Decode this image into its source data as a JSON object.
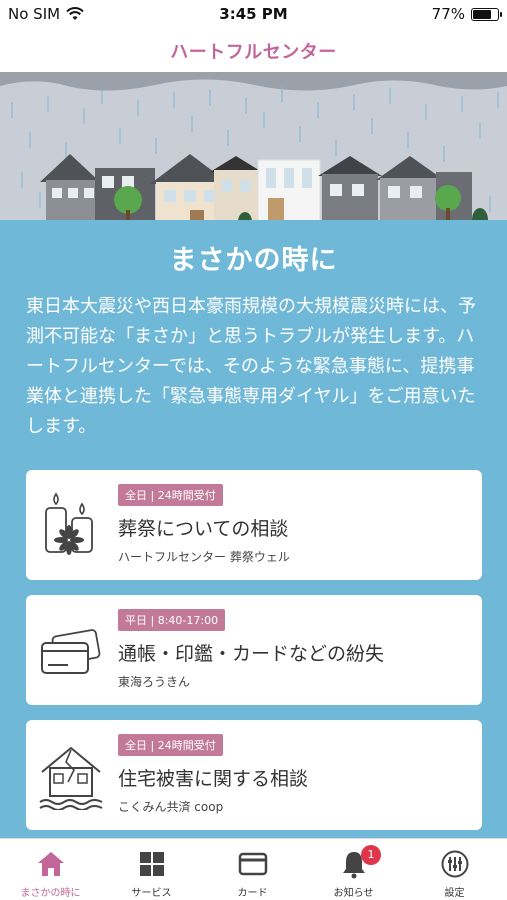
{
  "status_bar": {
    "carrier": "No SIM",
    "time": "3:45 PM",
    "battery_percent": "77%",
    "battery_level": 0.77
  },
  "nav": {
    "title": "ハートフルセンター"
  },
  "main": {
    "section_title": "まさかの時に",
    "description": "東日本大震災や西日本豪雨規模の大規模震災時には、予測不可能な「まさか」と思うトラブルが発生します。ハートフルセンターでは、そのような緊急事態に、提携事業体と連携した「緊急事態専用ダイヤル」をご用意いたします。",
    "cards": [
      {
        "badge": "全日 | 24時間受付",
        "title": "葬祭についての相談",
        "subtitle": "ハートフルセンター 葬祭ウェル",
        "icon": "candles-icon"
      },
      {
        "badge": "平日 | 8:40-17:00",
        "title": "通帳・印鑑・カードなどの紛失",
        "subtitle": "東海ろうきん",
        "icon": "cards-icon"
      },
      {
        "badge": "全日 | 24時間受付",
        "title": "住宅被害に関する相談",
        "subtitle": "こくみん共済 coop",
        "icon": "damaged-house-icon"
      }
    ]
  },
  "tabs": [
    {
      "label": "まさかの時に",
      "icon": "home-icon",
      "active": true
    },
    {
      "label": "サービス",
      "icon": "grid-icon",
      "active": false
    },
    {
      "label": "カード",
      "icon": "card-icon",
      "active": false
    },
    {
      "label": "お知らせ",
      "icon": "bell-icon",
      "active": false,
      "badge": "1"
    },
    {
      "label": "設定",
      "icon": "settings-icon",
      "active": false
    }
  ],
  "colors": {
    "brand_pink": "#c2669a",
    "badge_pink": "#c27a98",
    "main_blue": "#6fb8d8",
    "notification_red": "#e0364c"
  }
}
